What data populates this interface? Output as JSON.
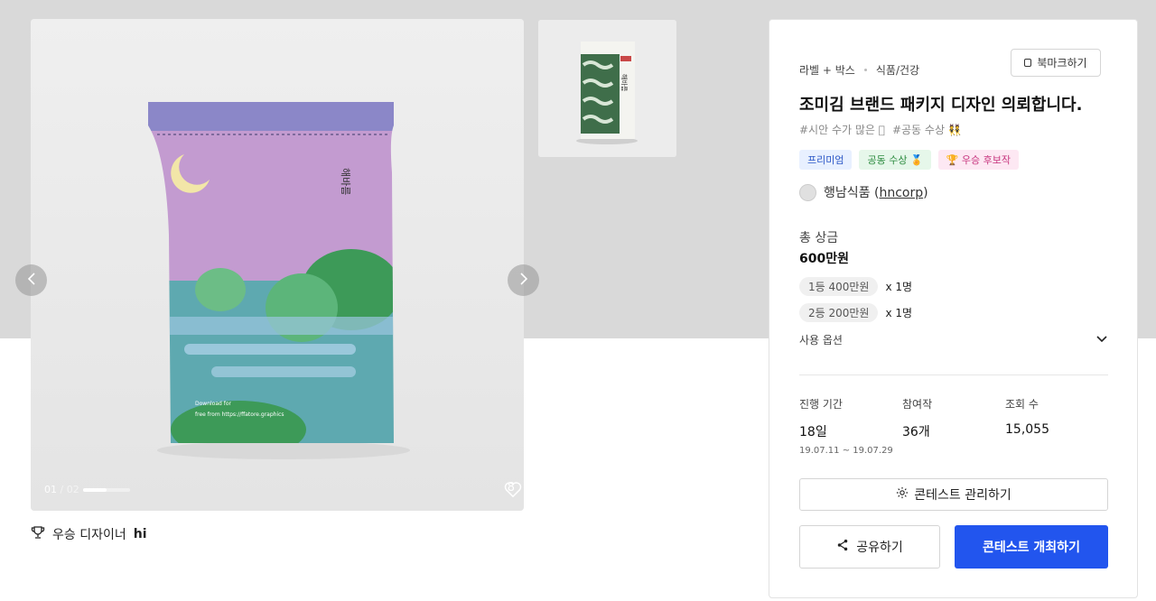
{
  "colors": {
    "hero_bg": "#d9d9d9",
    "primary": "#2255ee",
    "bag_purple": "#c49ad0",
    "bag_teal": "#5aa3a8",
    "bag_green": "#3f9a5a"
  },
  "gallery": {
    "current": "01",
    "separator": " / ",
    "total": "02",
    "progress_fraction": 0.5,
    "like_count": "8",
    "prev_icon": "chevron-left-icon",
    "next_icon": "chevron-right-icon"
  },
  "designer": {
    "icon": "trophy-icon",
    "label": "우승 디자이너",
    "name": "hi"
  },
  "contest": {
    "category": "라벨 + 박스",
    "subcategory": "식품/건강",
    "bookmark_label": "북마크하기",
    "title": "조미김 브랜드 패키지 디자인 의뢰합니다.",
    "hashtags": [
      "#시안 수가 많은 🏽",
      "#공동 수상 👯"
    ],
    "badges": [
      {
        "label": "프리미엄",
        "type": "premium"
      },
      {
        "label": "공동 수상 🏅",
        "type": "joint"
      },
      {
        "label": "🏆 우승 후보작",
        "type": "excellent"
      }
    ],
    "host_name": "행남식품",
    "host_id": "hncorp"
  },
  "prize": {
    "label": "총 상금",
    "total": "600만원",
    "rows": [
      {
        "rank": "1등 400만원",
        "count": "x 1명"
      },
      {
        "rank": "2등 200만원",
        "count": "x 1명"
      }
    ],
    "options_label": "사용 옵션"
  },
  "stats": {
    "period_label": "진행 기간",
    "period_value": "18일",
    "period_range": "19.07.11 ~ 19.07.29",
    "entries_label": "참여작",
    "entries_value": "36개",
    "views_label": "조회 수",
    "views_value": "15,055"
  },
  "actions": {
    "manage_label": "콘테스트 관리하기",
    "share_label": "공유하기",
    "host_label": "콘테스트 개최하기"
  }
}
